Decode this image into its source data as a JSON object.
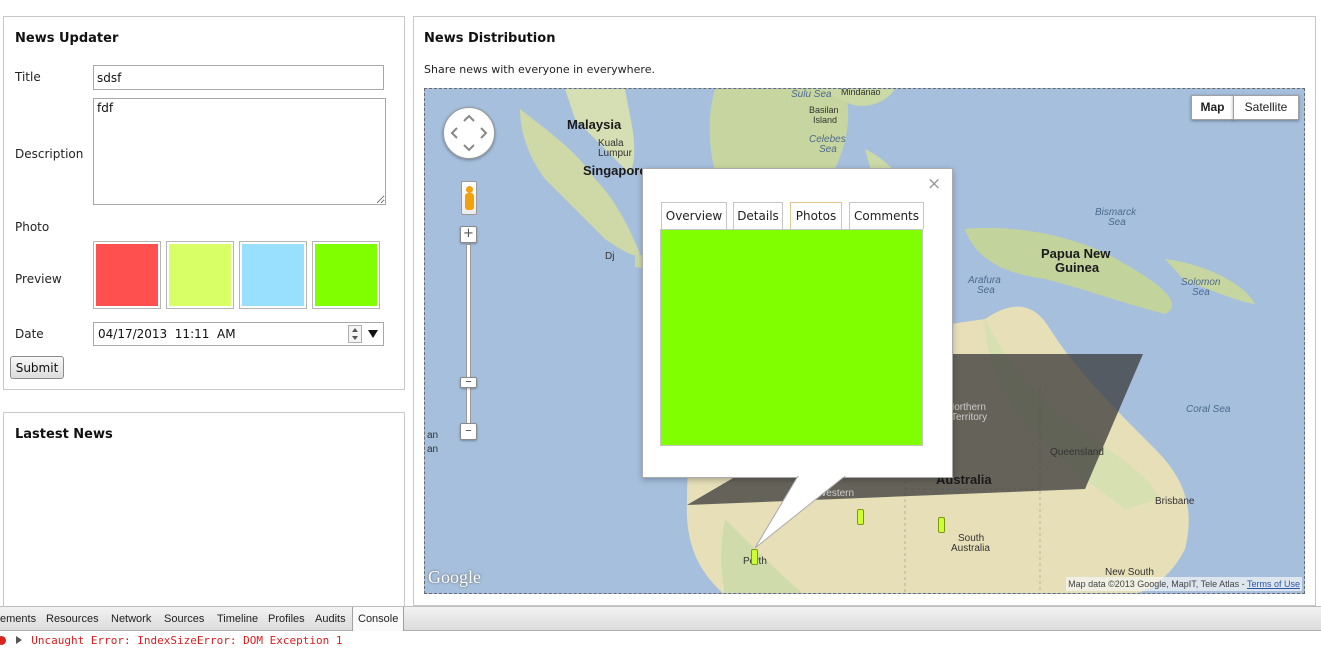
{
  "updater": {
    "heading": "News Updater",
    "title_label": "Title",
    "title_value": "sdsf",
    "description_label": "Description",
    "description_value": "fdf",
    "photo_label": "Photo",
    "preview_label": "Preview",
    "preview_colors": [
      "#ff5050",
      "#d9ff66",
      "#99e0ff",
      "#80ff00"
    ],
    "date_label": "Date",
    "date_value": "04/17/2013  11:11  AM",
    "submit_label": "Submit"
  },
  "latest": {
    "heading": "Lastest News"
  },
  "distribution": {
    "heading": "News Distribution",
    "subtitle": "Share news with everyone in everywhere."
  },
  "map": {
    "type_controls": {
      "map": "Map",
      "satellite": "Satellite"
    },
    "labels": {
      "malaysia": "Malaysia",
      "kuala": "Kuala",
      "lumpur": "Lumpur",
      "singapore": "Singapore",
      "sulu_sea": "Sulu Sea",
      "mindanao": "Mindanao",
      "sabah": "Basilan",
      "island": "Island",
      "celebes": "Celebes",
      "celebes_sea": "Sea",
      "bismarck": "Bismarck",
      "bismarck_sea": "Sea",
      "png1": "Papua New",
      "png2": "Guinea",
      "arafura": "Arafura",
      "arafura_sea": "Sea",
      "solomon": "Solomon",
      "solomon_sea": "Sea",
      "coral_sea": "Coral Sea",
      "northern": "Northern",
      "territory": "Territory",
      "queensland": "Queensland",
      "australia": "Australia",
      "western": "Western",
      "brisbane": "Brisbane",
      "south1": "South",
      "south2": "Australia",
      "perth": "Perth",
      "nsw": "New South",
      "dj": "Dj",
      "an1": "an",
      "an2": "an"
    },
    "google_logo": "Google",
    "attribution": "Map data ©2013 Google, MapIT, Tele Atlas - ",
    "terms": "Terms of Use",
    "marker_colors": [
      "#ccff33",
      "#ccff33",
      "#ccff33"
    ]
  },
  "infowindow": {
    "tabs": [
      "Overview",
      "Details",
      "Photos",
      "Comments"
    ],
    "active_tab": "Photos",
    "photo_color": "#80ff00",
    "close_symbol": "×"
  },
  "devtools": {
    "tabs": [
      "ements",
      "Resources",
      "Network",
      "Sources",
      "Timeline",
      "Profiles",
      "Audits",
      "Console"
    ],
    "active_tab": "Console",
    "error_text": "Uncaught Error: IndexSizeError: DOM Exception 1"
  }
}
